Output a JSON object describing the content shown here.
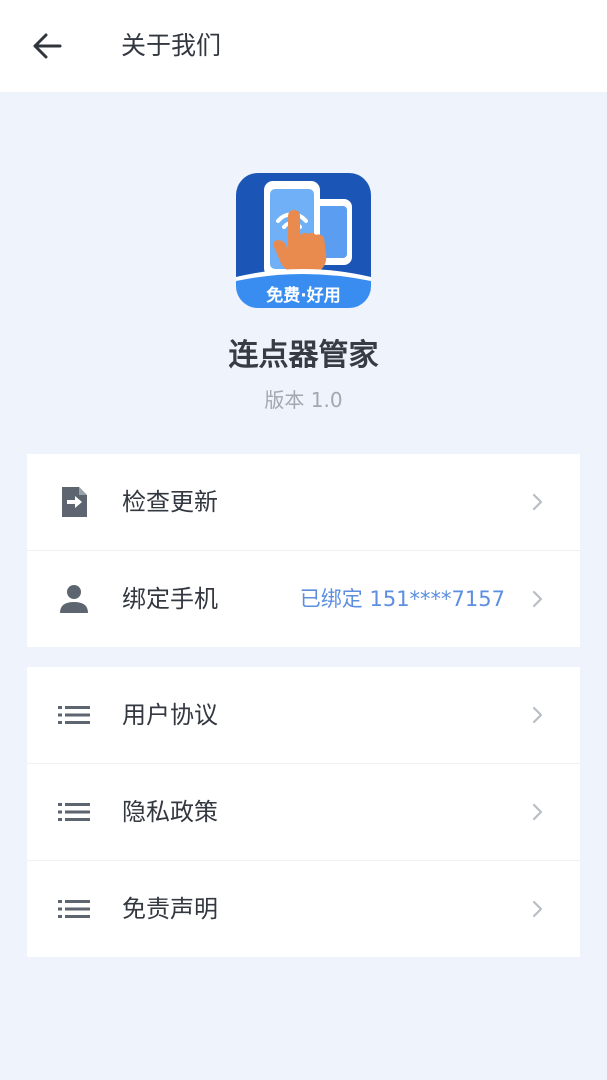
{
  "header": {
    "title": "关于我们",
    "back_icon": "arrow-left-icon"
  },
  "app": {
    "name": "连点器管家",
    "version": "版本 1.0",
    "logo_text": "免费·好用",
    "logo_icon": "tap-hand-phone-icon"
  },
  "group1": [
    {
      "label": "检查更新",
      "value": "",
      "icon": "document-arrow-icon"
    },
    {
      "label": "绑定手机",
      "value": "已绑定 151****7157",
      "icon": "user-icon"
    }
  ],
  "group2": [
    {
      "label": "用户协议",
      "icon": "list-icon"
    },
    {
      "label": "隐私政策",
      "icon": "list-icon"
    },
    {
      "label": "免责声明",
      "icon": "list-icon"
    }
  ],
  "colors": {
    "background": "#eff3fb",
    "accent": "#5c8fe0",
    "logo_blue": "#1b56b7",
    "hand_orange": "#e98a4e"
  }
}
